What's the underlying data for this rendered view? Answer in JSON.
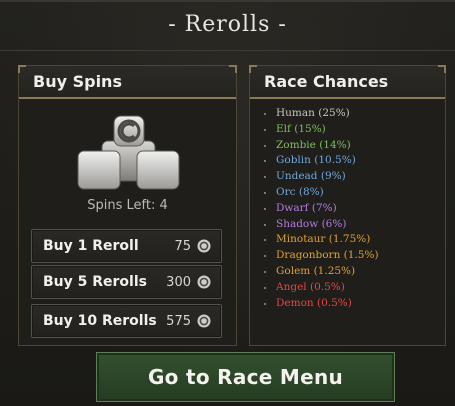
{
  "header": {
    "title": "- Rerolls -"
  },
  "buy_spins": {
    "heading": "Buy Spins",
    "icon": "reroll-token-stack-icon",
    "spins_left": "Spins Left: 4",
    "options": [
      {
        "label": "Buy 1 Reroll",
        "cost": "75",
        "currency_icon": "coin-icon"
      },
      {
        "label": "Buy 5 Rerolls",
        "cost": "300",
        "currency_icon": "coin-icon"
      },
      {
        "label": "Buy 10 Rerolls",
        "cost": "575",
        "currency_icon": "coin-icon"
      }
    ]
  },
  "race_chances": {
    "heading": "Race Chances",
    "items": [
      {
        "text": "Human (25%)",
        "color": "#c9c6be"
      },
      {
        "text": "Elf (15%)",
        "color": "#7fbf5e"
      },
      {
        "text": "Zombie (14%)",
        "color": "#7fbf5e"
      },
      {
        "text": "Goblin (10.5%)",
        "color": "#6fa8dc"
      },
      {
        "text": "Undead (9%)",
        "color": "#6fa8dc"
      },
      {
        "text": "Orc (8%)",
        "color": "#6fa8dc"
      },
      {
        "text": "Dwarf (7%)",
        "color": "#b57be0"
      },
      {
        "text": "Shadow (6%)",
        "color": "#b57be0"
      },
      {
        "text": "Minotaur (1.75%)",
        "color": "#e0a030"
      },
      {
        "text": "Dragonborn (1.5%)",
        "color": "#e0a030"
      },
      {
        "text": "Golem (1.25%)",
        "color": "#e0a030"
      },
      {
        "text": "Angel (0.5%)",
        "color": "#e04848"
      },
      {
        "text": "Demon (0.5%)",
        "color": "#e04848"
      }
    ]
  },
  "footer": {
    "go_button_label": "Go to Race Menu"
  }
}
